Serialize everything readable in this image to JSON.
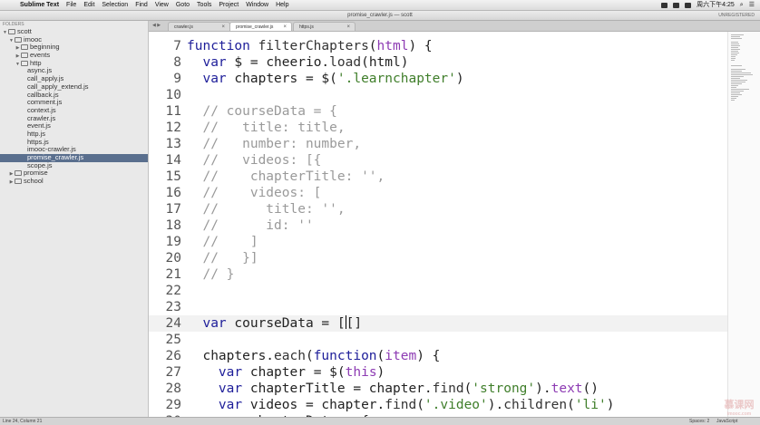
{
  "menubar": {
    "items": [
      "Sublime Text",
      "File",
      "Edit",
      "Selection",
      "Find",
      "View",
      "Goto",
      "Tools",
      "Project",
      "Window",
      "Help"
    ],
    "clock": "周六下午4:25"
  },
  "window": {
    "title": "promise_crawler.js — scott",
    "right_label": "UNREGISTERED"
  },
  "sidebar": {
    "header": "FOLDERS",
    "tree": [
      {
        "label": "scott",
        "type": "folder",
        "open": true,
        "depth": 0
      },
      {
        "label": "imooc",
        "type": "folder",
        "open": true,
        "depth": 1
      },
      {
        "label": "beginning",
        "type": "folder",
        "open": false,
        "depth": 2
      },
      {
        "label": "events",
        "type": "folder",
        "open": false,
        "depth": 2
      },
      {
        "label": "http",
        "type": "folder",
        "open": true,
        "depth": 2
      },
      {
        "label": "async.js",
        "type": "file",
        "depth": 3
      },
      {
        "label": "call_apply.js",
        "type": "file",
        "depth": 3
      },
      {
        "label": "call_apply_extend.js",
        "type": "file",
        "depth": 3
      },
      {
        "label": "callback.js",
        "type": "file",
        "depth": 3
      },
      {
        "label": "comment.js",
        "type": "file",
        "depth": 3
      },
      {
        "label": "context.js",
        "type": "file",
        "depth": 3
      },
      {
        "label": "crawler.js",
        "type": "file",
        "depth": 3
      },
      {
        "label": "event.js",
        "type": "file",
        "depth": 3
      },
      {
        "label": "http.js",
        "type": "file",
        "depth": 3
      },
      {
        "label": "https.js",
        "type": "file",
        "depth": 3
      },
      {
        "label": "imooc-crawler.js",
        "type": "file",
        "depth": 3
      },
      {
        "label": "promise_crawler.js",
        "type": "file",
        "depth": 3,
        "selected": true
      },
      {
        "label": "scope.js",
        "type": "file",
        "depth": 3
      },
      {
        "label": "promise",
        "type": "folder",
        "open": false,
        "depth": 1
      },
      {
        "label": "school",
        "type": "folder",
        "open": false,
        "depth": 1
      }
    ]
  },
  "tabs": [
    {
      "label": "crawler.js",
      "active": false
    },
    {
      "label": "promise_crawler.js",
      "active": true
    },
    {
      "label": "https.js",
      "active": false
    }
  ],
  "editor": {
    "lines": [
      {
        "n": "7",
        "html": "<span class=\"kw\">function</span> <span class=\"fn\">filterChapters</span>(<span class=\"th\">html</span>) {"
      },
      {
        "n": "8",
        "html": "  <span class=\"kw\">var</span> $ = cheerio.<span class=\"fn\">load</span>(html)"
      },
      {
        "n": "9",
        "html": "  <span class=\"kw\">var</span> chapters = $(<span class=\"str\">'.learnchapter'</span>)"
      },
      {
        "n": "10",
        "html": ""
      },
      {
        "n": "11",
        "html": "  <span class=\"cm\">// courseData = {</span>"
      },
      {
        "n": "12",
        "html": "  <span class=\"cm\">//   title: title,</span>"
      },
      {
        "n": "13",
        "html": "  <span class=\"cm\">//   number: number,</span>"
      },
      {
        "n": "14",
        "html": "  <span class=\"cm\">//   videos: [{</span>"
      },
      {
        "n": "15",
        "html": "  <span class=\"cm\">//    chapterTitle: '',</span>"
      },
      {
        "n": "16",
        "html": "  <span class=\"cm\">//    videos: [</span>"
      },
      {
        "n": "17",
        "html": "  <span class=\"cm\">//      title: '',</span>"
      },
      {
        "n": "18",
        "html": "  <span class=\"cm\">//      id: ''</span>"
      },
      {
        "n": "19",
        "html": "  <span class=\"cm\">//    ]</span>"
      },
      {
        "n": "20",
        "html": "  <span class=\"cm\">//   }]</span>"
      },
      {
        "n": "21",
        "html": "  <span class=\"cm\">// }</span>"
      },
      {
        "n": "22",
        "html": ""
      },
      {
        "n": "23",
        "html": ""
      },
      {
        "n": "24",
        "html": "  <span class=\"kw\">var</span> courseData = [<span class=\"cursor\"></span>[]"
      },
      {
        "n": "25",
        "html": ""
      },
      {
        "n": "26",
        "html": "  chapters.<span class=\"fn\">each</span>(<span class=\"kw\">function</span>(<span class=\"th\">item</span>) {"
      },
      {
        "n": "27",
        "html": "    <span class=\"kw\">var</span> chapter = $(<span class=\"th\">this</span>)"
      },
      {
        "n": "28",
        "html": "    <span class=\"kw\">var</span> chapterTitle = chapter.<span class=\"fn\">find</span>(<span class=\"str\">'strong'</span>).<span class=\"th\">text</span>()"
      },
      {
        "n": "29",
        "html": "    <span class=\"kw\">var</span> videos = chapter.<span class=\"fn\">find</span>(<span class=\"str\">'.video'</span>).<span class=\"fn\">children</span>(<span class=\"str\">'li'</span>)"
      },
      {
        "n": "30",
        "html": "    <span class=\"kw\">var</span> chapterData = {"
      }
    ],
    "current_line": "24"
  },
  "statusbar": {
    "position": "Line 24, Column 21",
    "spaces": "Spaces: 2",
    "syntax": "JavaScript"
  },
  "watermark": {
    "logo": "慕课网",
    "text": "imooc.com"
  }
}
